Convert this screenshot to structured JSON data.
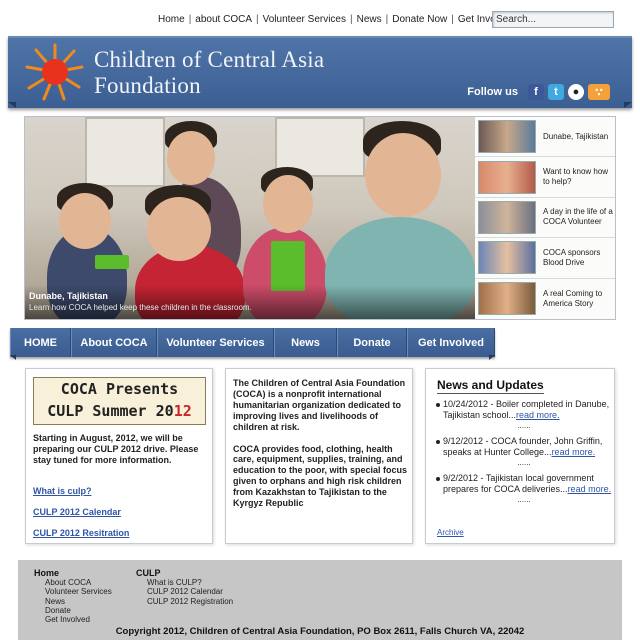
{
  "top_nav": {
    "items": [
      "Home",
      "about COCA",
      "Volunteer Services",
      "News",
      "Donate Now",
      "Get Involved"
    ],
    "search_placeholder": "Search..."
  },
  "header": {
    "title_line1": "Children of Central Asia",
    "title_line2": "Foundation",
    "follow_label": "Follow us",
    "social_icons": [
      "facebook-icon",
      "twitter-icon",
      "reddit-icon",
      "rss-icon"
    ]
  },
  "hero": {
    "caption_title": "Dunabe, Tajikistan",
    "caption_text": "Learn how COCA helped keep these children in the classroom."
  },
  "sidebar_items": [
    {
      "text": "Dunabe, Tajikistan"
    },
    {
      "text": "Want to know how to help?"
    },
    {
      "text": "A day in the life of a COCA Volunteer"
    },
    {
      "text": "COCA sponsors Blood Drive"
    },
    {
      "text": "A real Coming to America Story"
    }
  ],
  "main_nav": {
    "items": [
      "HOME",
      "About COCA",
      "Volunteer Services",
      "News",
      "Donate",
      "Get Involved"
    ]
  },
  "left_box": {
    "banner_line1": "COCA Presents",
    "banner_line2a": "CULP Summer 20",
    "banner_line2b": "12",
    "text": "Starting in August, 2012, we will be preparing our CULP 2012 drive. Please stay tuned for more information.",
    "links": [
      "What is culp?",
      "CULP 2012 Calendar",
      "CULP 2012 Resitration"
    ]
  },
  "mid_box": {
    "para1": "The Children of Central Asia Foundation (COCA) is a nonprofit international humanitarian organization dedicated to improving lives and livelihoods of children at risk.",
    "para2": "COCA provides food, clothing, health care, equipment, supplies, training, and education to the poor, with special focus given to orphans and high risk children from Kazakhstan to Tajikistan to the Kyrgyz Republic"
  },
  "news": {
    "title": "News and Updates",
    "items": [
      {
        "text": "10/24/2012 - Boiler completed in Danube, Tajikistan school...",
        "link": "read more."
      },
      {
        "text": "9/12/2012 - COCA founder, John Griffin, speaks at Hunter College...",
        "link": "read more."
      },
      {
        "text": "9/2/2012 - Tajikistan local government prepares for COCA deliveries...",
        "link": "read more."
      }
    ],
    "dots": "......",
    "archive": "Archive"
  },
  "footer": {
    "col1_head": "Home",
    "col1_links": [
      "About COCA",
      "Volunteer Services",
      "News",
      "Donate",
      "Get Involved"
    ],
    "col2_head": "CULP",
    "col2_links": [
      "What is CULP?",
      "CULP 2012 Calendar",
      "CULP 2012 Registration"
    ],
    "copyright": "Copyright 2012, Children of Central Asia Foundation, PO Box 2611, Falls Church VA, 22042"
  },
  "colors": {
    "header_blue": "#4a6fa3",
    "link_blue": "#2f55a8",
    "footer_gray": "#c6c6c6",
    "culp_red": "#c8262c"
  }
}
